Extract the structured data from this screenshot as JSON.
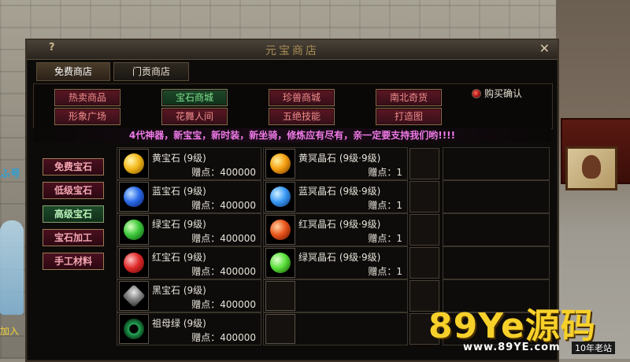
{
  "window": {
    "title": "元宝商店",
    "help": "?",
    "close": "✕"
  },
  "tabs": [
    "免费商店",
    "门贡商店"
  ],
  "topnav": {
    "row1": [
      "热卖商品",
      "宝石商城",
      "珍兽商城",
      "南北奇货"
    ],
    "row2": [
      "形象广场",
      "花舞人间",
      "五绝技能",
      "打造图"
    ],
    "selected": "宝石商城",
    "buy_confirm": "购买确认"
  },
  "marquee": "4代神器，新宝宝，新时装，新坐骑，修炼应有尽有，亲一定要支持我们哟!!!!",
  "sidebar": {
    "items": [
      "免费宝石",
      "低级宝石",
      "高级宝石",
      "宝石加工",
      "手工材料"
    ],
    "selected": "高级宝石"
  },
  "items_left": [
    {
      "name": "黄宝石 (9级)",
      "price": "赠点：400000",
      "icon": "yellow-gem-icon",
      "color": "#f2b81a"
    },
    {
      "name": "蓝宝石 (9级)",
      "price": "赠点：400000",
      "icon": "blue-gem-icon",
      "color": "#2a6ae8"
    },
    {
      "name": "绿宝石 (9级)",
      "price": "赠点：400000",
      "icon": "green-gem-icon",
      "color": "#3cc83a"
    },
    {
      "name": "红宝石 (9级)",
      "price": "赠点：400000",
      "icon": "red-gem-icon",
      "color": "#e02a2a"
    },
    {
      "name": "黑宝石 (9级)",
      "price": "赠点：400000",
      "icon": "black-gem-icon",
      "color": "#8a8a8a"
    },
    {
      "name": "祖母绿 (9级)",
      "price": "赠点：400000",
      "icon": "emerald-gem-icon",
      "color": "#28a85a"
    }
  ],
  "items_right": [
    {
      "name": "黄冥晶石 (9级·9级)",
      "price": "赠点：1",
      "icon": "yellow-crystal-icon",
      "color": "#f5a010"
    },
    {
      "name": "蓝冥晶石 (9级·9级)",
      "price": "赠点：1",
      "icon": "blue-crystal-icon",
      "color": "#3a9af5"
    },
    {
      "name": "红冥晶石 (9级·9级)",
      "price": "赠点：1",
      "icon": "red-crystal-icon",
      "color": "#e8541a"
    },
    {
      "name": "绿冥晶石 (9级·9级)",
      "price": "赠点：1",
      "icon": "green-crystal-icon",
      "color": "#5ae03a"
    }
  ],
  "background": {
    "left_text": "ふ号",
    "left_text2": "加入"
  },
  "watermark": {
    "main": "89Ye源码",
    "sub": "www.89YE.com",
    "badge": "10年老站"
  }
}
